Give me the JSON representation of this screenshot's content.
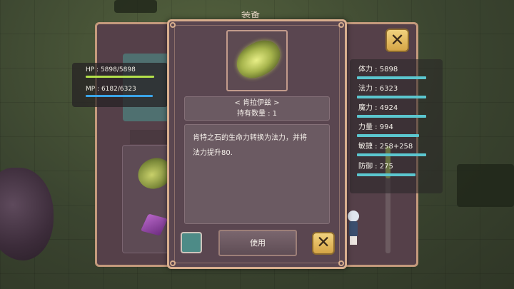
{
  "back_window": {
    "title": "装备",
    "close_label": "✕"
  },
  "player": {
    "hp_text": "HP : 5898/5898",
    "mp_text": "MP : 6182/6323",
    "hp_fraction": 1.0,
    "mp_fraction": 0.978,
    "hp_color": "#b3e04a",
    "mp_color": "#3aa4e8"
  },
  "stats": [
    {
      "label": "体力 : 5898",
      "fill": 1.0
    },
    {
      "label": "法力 : 6323",
      "fill": 1.0
    },
    {
      "label": "魔力 : 4924",
      "fill": 1.0
    },
    {
      "label": "力量 : 994",
      "fill": 0.9
    },
    {
      "label": "敏捷 : 258+258",
      "fill": 1.0
    },
    {
      "label": "防御 : 275",
      "fill": 0.85
    }
  ],
  "stat_bar_color": "#5bc6cf",
  "item_dialog": {
    "item_icon": "green-glowing-stone-icon",
    "item_name": "< 肯拉伊兹 >",
    "quantity": "持有数量 : 1",
    "description_line1": "肯特之石的生命力转换为法力，并将",
    "description_line2": "法力提升80.",
    "use_button": "使用",
    "close_label": "✕"
  }
}
